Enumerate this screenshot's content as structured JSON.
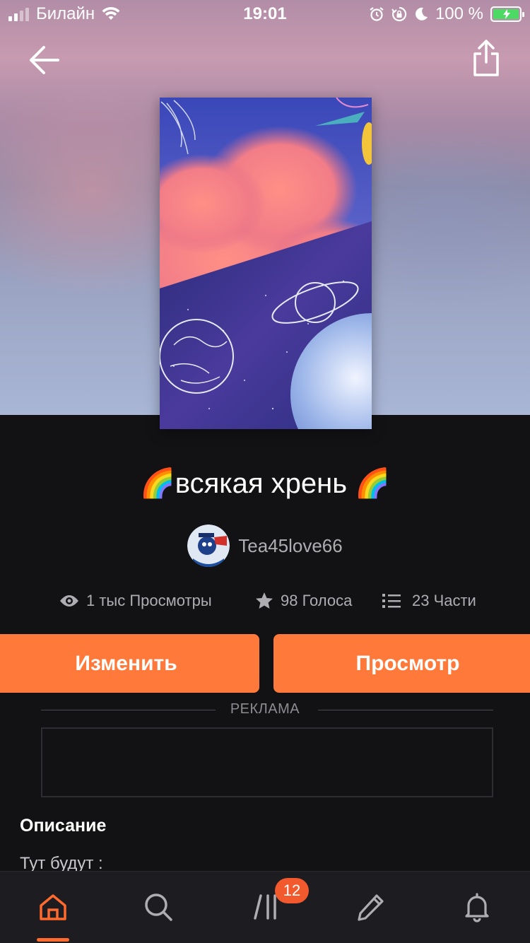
{
  "status_bar": {
    "carrier": "Билайн",
    "time": "19:01",
    "battery": "100 %"
  },
  "story": {
    "title": "🌈всякая хрень 🌈",
    "author": "Tea45love66",
    "stats": {
      "views": "1 тыс Просмотры",
      "votes": "98 Голоса",
      "parts": "23 Части"
    }
  },
  "actions": {
    "edit_label": "Изменить",
    "view_label": "Просмотр"
  },
  "ad": {
    "label": "РЕКЛАМА"
  },
  "description": {
    "heading": "Описание",
    "text": "Тут будут :"
  },
  "tabbar": {
    "items": [
      {
        "icon": "home-icon",
        "active": true
      },
      {
        "icon": "search-icon",
        "active": false
      },
      {
        "icon": "library-icon",
        "active": false
      },
      {
        "icon": "pencil-icon",
        "active": false
      },
      {
        "icon": "bell-icon",
        "active": false
      }
    ],
    "library_badge": "12"
  },
  "colors": {
    "accent": "#ff7a3a",
    "background": "#121114",
    "tabbar": "#1d1c21"
  }
}
